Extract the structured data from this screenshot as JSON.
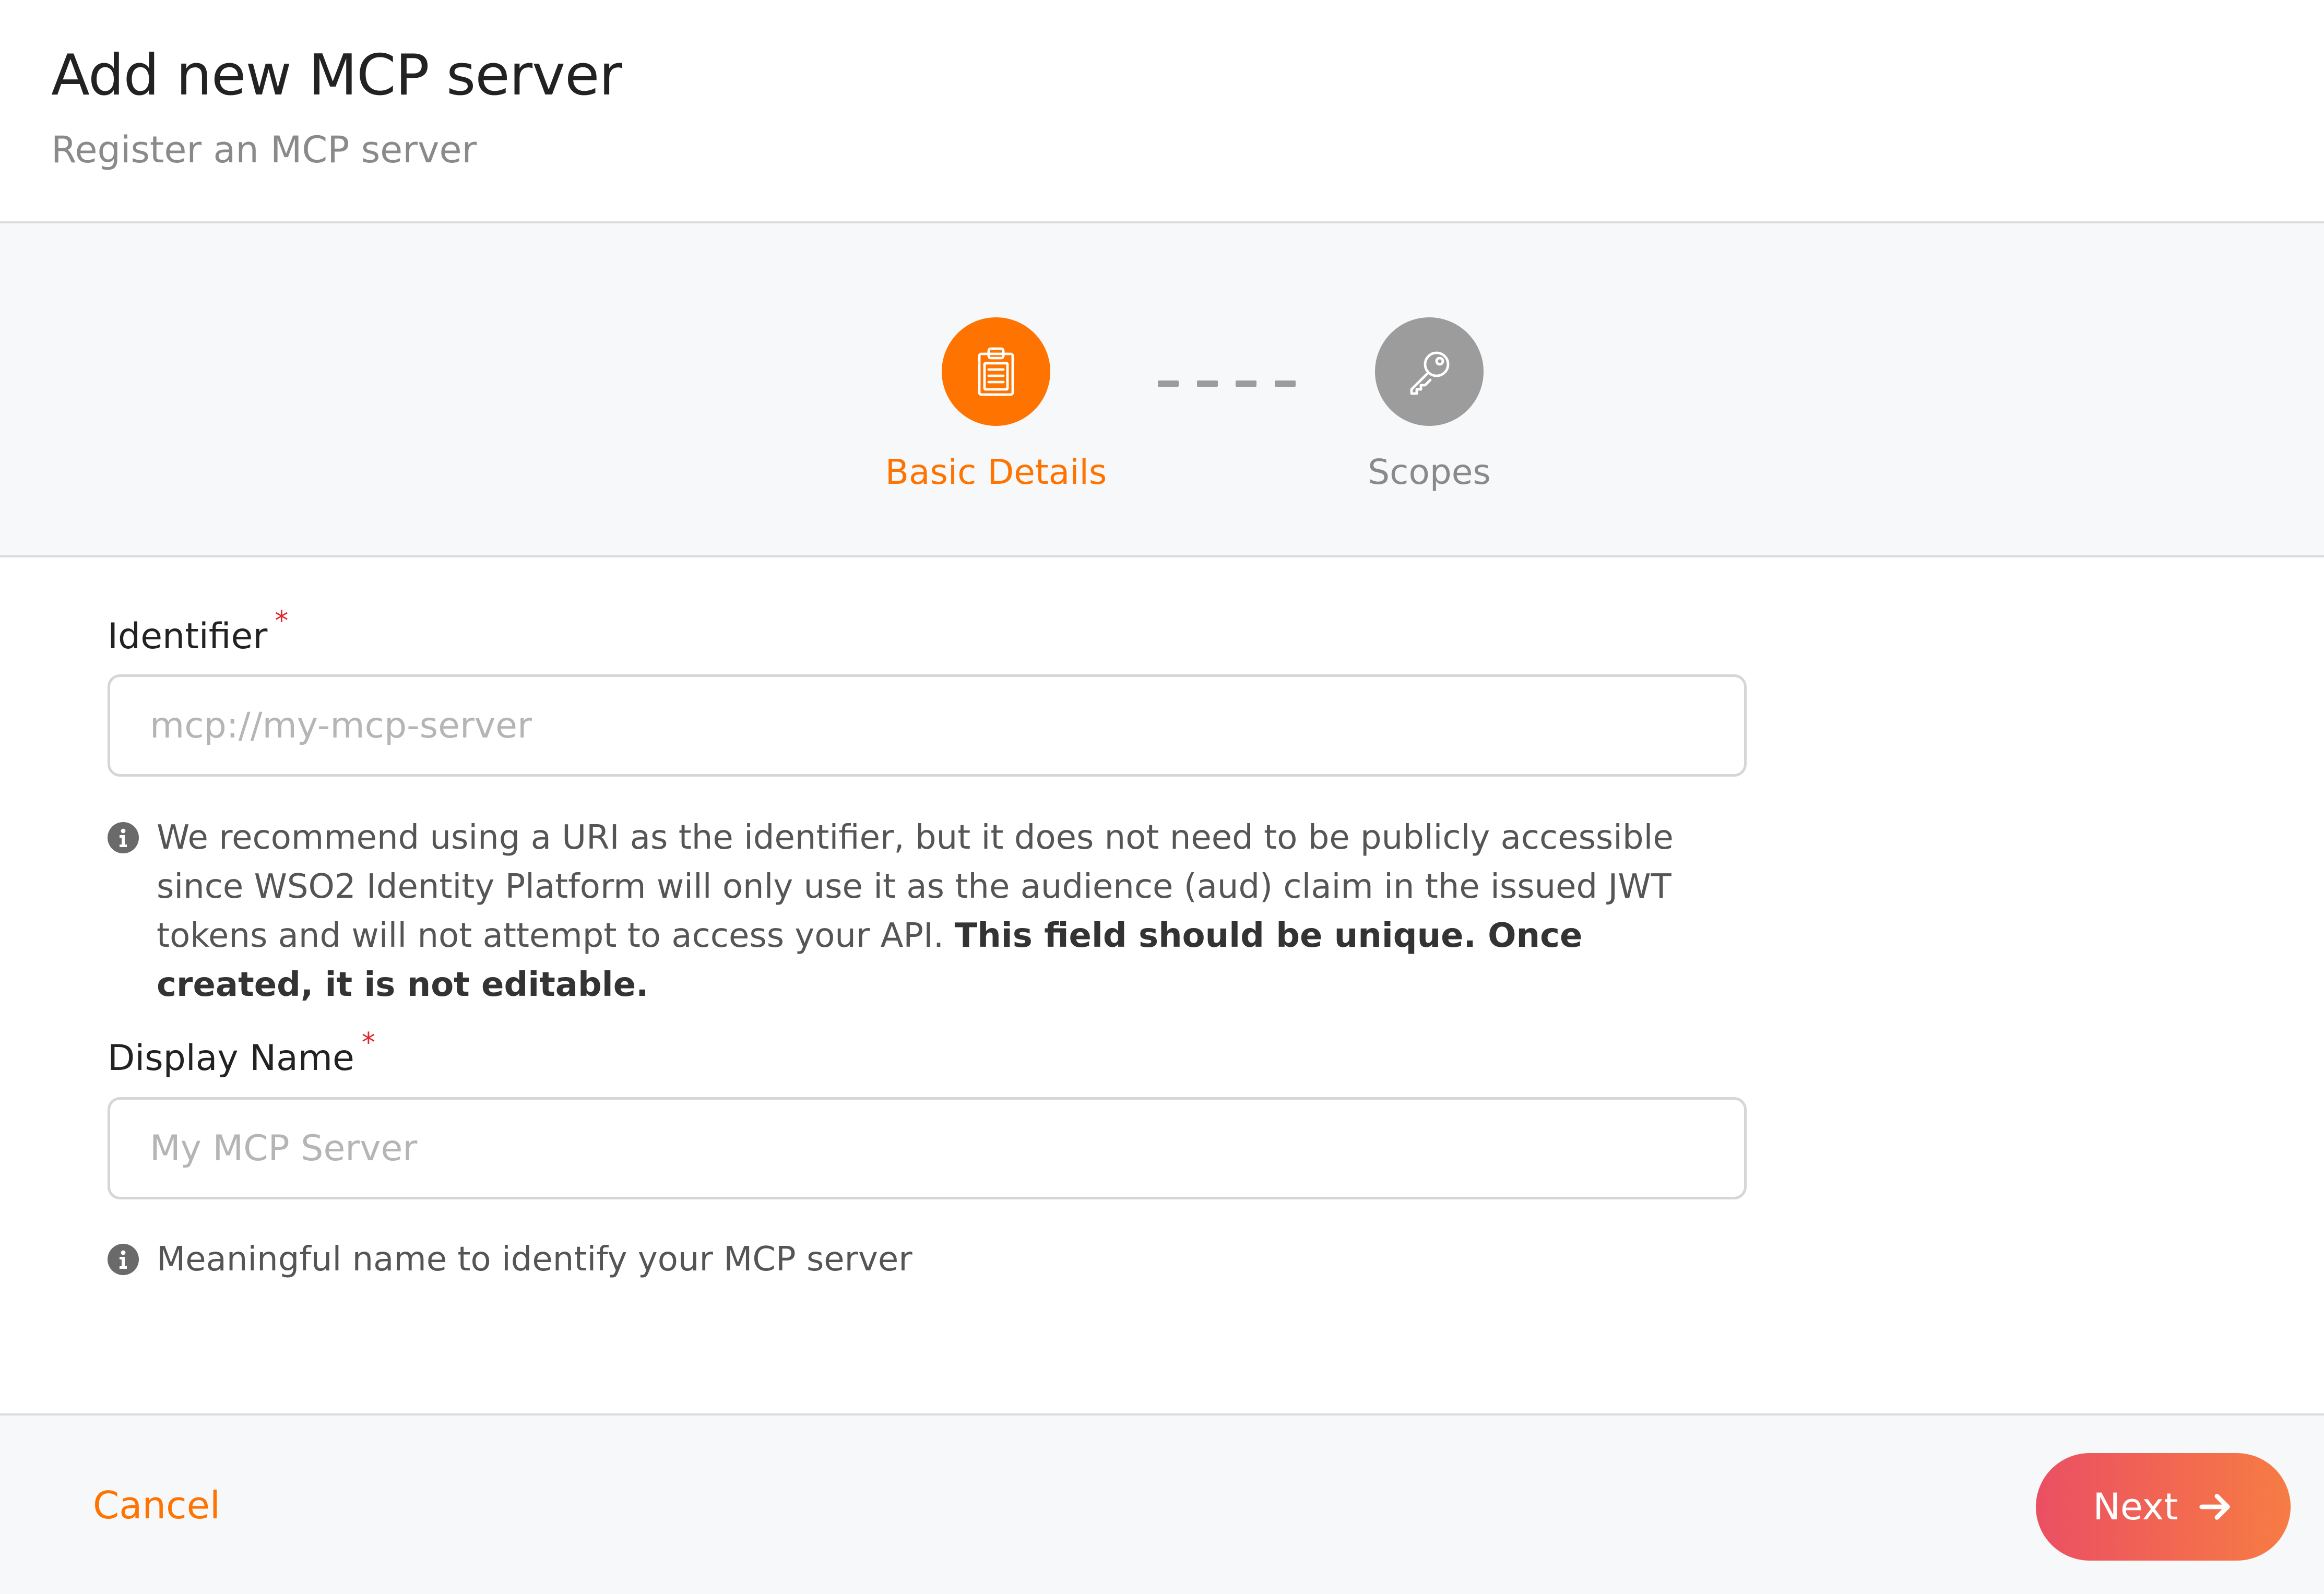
{
  "header": {
    "title": "Add new MCP server",
    "subtitle": "Register an MCP server"
  },
  "stepper": {
    "steps": [
      {
        "label": "Basic Details",
        "icon": "clipboard-icon",
        "state": "active"
      },
      {
        "label": "Scopes",
        "icon": "key-icon",
        "state": "inactive"
      }
    ]
  },
  "form": {
    "identifier": {
      "label": "Identifier",
      "required_mark": "*",
      "value": "",
      "placeholder": "mcp://my-mcp-server",
      "hint": "We recommend using a URI as the identifier, but it does not need to be publicly accessible since WSO2 Identity Platform will only use it as the audience (aud) claim in the issued JWT tokens and will not attempt to access your API.",
      "hint_bold": "This field should be unique. Once created, it is not editable."
    },
    "display_name": {
      "label": "Display Name",
      "required_mark": "*",
      "value": "",
      "placeholder": "My MCP Server",
      "hint": "Meaningful name to identify your MCP server"
    }
  },
  "footer": {
    "cancel_label": "Cancel",
    "next_label": "Next"
  },
  "colors": {
    "accent": "#ff7300",
    "inactive": "#9c9c9c",
    "required": "#e0262f",
    "next_gradient_start": "#eb4f63",
    "next_gradient_end": "#f77c43"
  }
}
